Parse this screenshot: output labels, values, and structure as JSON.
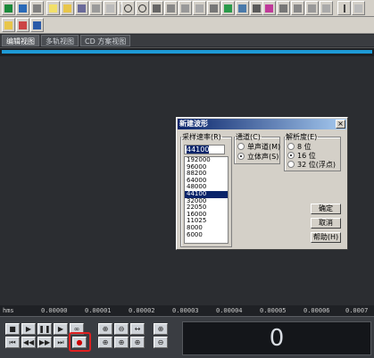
{
  "tabs": [
    "编辑视图",
    "多轨视图",
    "CD 方案视图"
  ],
  "ruler": {
    "unit": "hms",
    "ticks": [
      "0.00000",
      "0.00001",
      "0.00002",
      "0.00003",
      "0.00004",
      "0.00005",
      "0.00006",
      "0.0007"
    ]
  },
  "counter": "0",
  "dialog": {
    "title": "新建波形",
    "close": "×",
    "sample_rate": {
      "label": "采样速率(R)",
      "value": "44100",
      "options": [
        "192000",
        "96000",
        "88200",
        "64000",
        "48000",
        "44100",
        "32000",
        "22050",
        "16000",
        "11025",
        "8000",
        "6000"
      ],
      "selected": "44100"
    },
    "channels": {
      "label": "通道(C)",
      "options": [
        "单声道(M)",
        "立体声(S)"
      ],
      "selected": "立体声(S)"
    },
    "resolution": {
      "label": "解析度(E)",
      "options": [
        "8 位",
        "16 位",
        "32 位(浮点)"
      ],
      "selected": "16 位"
    },
    "buttons": {
      "ok": "确定",
      "cancel": "取消",
      "help": "帮助(H)"
    }
  },
  "colors": {
    "title_bar": "#0a246a",
    "record_highlight": "#e02020",
    "overview": "#1e9ad6"
  },
  "icons": [
    "new-file-icon",
    "open-file-icon",
    "save-icon",
    "undo-icon",
    "redo-icon",
    "cut-icon",
    "copy-icon",
    "paste-icon",
    "play-icon",
    "stop-icon",
    "pause-icon",
    "record-icon",
    "rewind-icon",
    "forward-icon",
    "zoom-in-icon",
    "zoom-out-icon"
  ]
}
